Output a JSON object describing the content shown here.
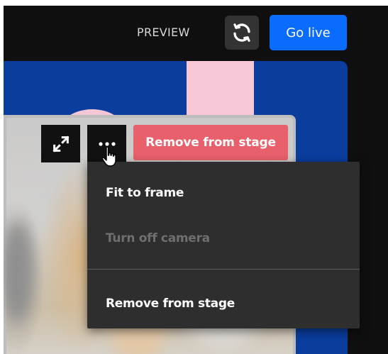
{
  "header": {
    "preview_label": "PREVIEW",
    "refresh_icon": "refresh-icon",
    "go_live_label": "Go live"
  },
  "tile_controls": {
    "expand_icon": "expand-arrows-icon",
    "more_icon": "more-dots-icon",
    "remove_button_label": "Remove from stage"
  },
  "menu": {
    "items": [
      {
        "label": "Fit to frame",
        "enabled": true
      },
      {
        "label": "Turn off camera",
        "enabled": false
      },
      {
        "label": "Remove from stage",
        "enabled": true
      }
    ]
  },
  "colors": {
    "go_live": "#0a6cff",
    "remove": "#e8606b",
    "stage_bg": "#0a3d9e",
    "menu_bg": "#2e2e2e"
  }
}
